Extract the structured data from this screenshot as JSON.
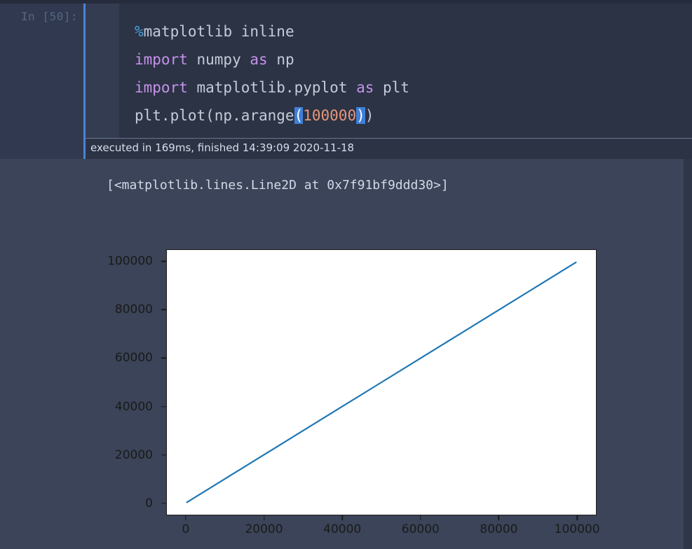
{
  "cell": {
    "prompt": "In [50]:",
    "code_lines": [
      {
        "tokens": [
          {
            "t": "%",
            "c": "magic"
          },
          {
            "t": "matplotlib inline",
            "c": "plain"
          }
        ]
      },
      {
        "tokens": [
          {
            "t": "import",
            "c": "kw"
          },
          {
            "t": " numpy ",
            "c": "plain"
          },
          {
            "t": "as",
            "c": "kw"
          },
          {
            "t": " np",
            "c": "plain"
          }
        ]
      },
      {
        "tokens": [
          {
            "t": "import",
            "c": "kw"
          },
          {
            "t": " matplotlib.pyplot ",
            "c": "plain"
          },
          {
            "t": "as",
            "c": "kw"
          },
          {
            "t": " plt",
            "c": "plain"
          }
        ]
      },
      {
        "tokens": [
          {
            "t": "plt.plot(np.arange",
            "c": "plain"
          },
          {
            "t": "(",
            "c": "match"
          },
          {
            "t": "100000",
            "c": "num"
          },
          {
            "t": ")",
            "c": "match"
          },
          {
            "t": ")",
            "c": "plain"
          }
        ]
      }
    ],
    "exec_status": "executed in 169ms, finished 14:39:09 2020-11-18"
  },
  "output": {
    "repr_text": "[<matplotlib.lines.Line2D at 0x7f91bf9ddd30>]"
  },
  "colors": {
    "line": "#1f77b4",
    "cell_bar": "#4a83d6",
    "cell_bg": "#2b3345",
    "output_bg": "#3b4458",
    "axis": "#1a1a1a"
  },
  "chart_data": {
    "type": "line",
    "title": "",
    "xlabel": "",
    "ylabel": "",
    "xlim": [
      -5000,
      105000
    ],
    "ylim": [
      -5000,
      105000
    ],
    "grid": false,
    "legend": null,
    "xticks": [
      0,
      20000,
      40000,
      60000,
      80000,
      100000
    ],
    "xtick_labels": [
      "0",
      "20000",
      "40000",
      "60000",
      "80000",
      "100000"
    ],
    "yticks": [
      0,
      20000,
      40000,
      60000,
      80000,
      100000
    ],
    "ytick_labels": [
      "0",
      "20000",
      "40000",
      "60000",
      "80000",
      "100000"
    ],
    "series": [
      {
        "name": "np.arange(100000)",
        "color": "#1f77b4",
        "linewidth": 1.5,
        "x": [
          0,
          10000,
          20000,
          30000,
          40000,
          50000,
          60000,
          70000,
          80000,
          90000,
          99999
        ],
        "y": [
          0,
          10000,
          20000,
          30000,
          40000,
          50000,
          60000,
          70000,
          80000,
          90000,
          99999
        ]
      }
    ]
  }
}
